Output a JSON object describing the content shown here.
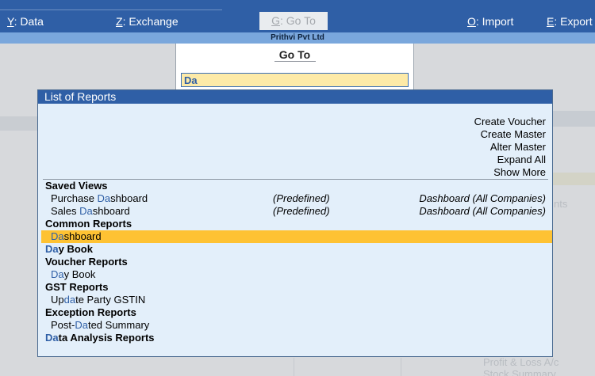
{
  "menu": {
    "data": {
      "key": "Y",
      "label": ": Data"
    },
    "exchange": {
      "key": "Z",
      "label": ": Exchange"
    },
    "goto": {
      "key": "G",
      "label": ": Go To"
    },
    "import": {
      "key": "O",
      "label": ": Import"
    },
    "export": {
      "key": "E",
      "label": ": Export"
    }
  },
  "company": "Prithvi Pvt Ltd",
  "goto": {
    "title": "Go To",
    "value": "Da"
  },
  "reports": {
    "title": "List of Reports",
    "actions": [
      "Create Voucher",
      "Create Master",
      "Alter Master",
      "Expand All",
      "Show More"
    ],
    "sections": [
      {
        "title": "Saved Views",
        "items": [
          {
            "label": "Purchase Dashboard",
            "mid": "(Predefined)",
            "right": "Dashboard (All Companies)"
          },
          {
            "label": "Sales Dashboard",
            "mid": "(Predefined)",
            "right": "Dashboard (All Companies)"
          }
        ]
      },
      {
        "title": "Common Reports",
        "items": [
          {
            "label": "Dashboard",
            "selected": true
          }
        ]
      },
      {
        "title": "Day Book",
        "items": []
      },
      {
        "title": "Voucher Reports",
        "items": [
          {
            "label": "Day Book"
          }
        ]
      },
      {
        "title": "GST Reports",
        "items": [
          {
            "label": "Update Party GSTIN"
          }
        ]
      },
      {
        "title": "Exception Reports",
        "items": [
          {
            "label": "Post-Dated Summary"
          }
        ]
      },
      {
        "title": "Data Analysis Reports",
        "items": []
      }
    ]
  },
  "background": {
    "right_fragment": "nts",
    "bottom_1": "Profit & Loss A/c",
    "bottom_2": "Stock Summary"
  },
  "colors": {
    "accent": "#2f5fa6",
    "selection": "#fec233",
    "input_bg": "#fdeaa7"
  }
}
